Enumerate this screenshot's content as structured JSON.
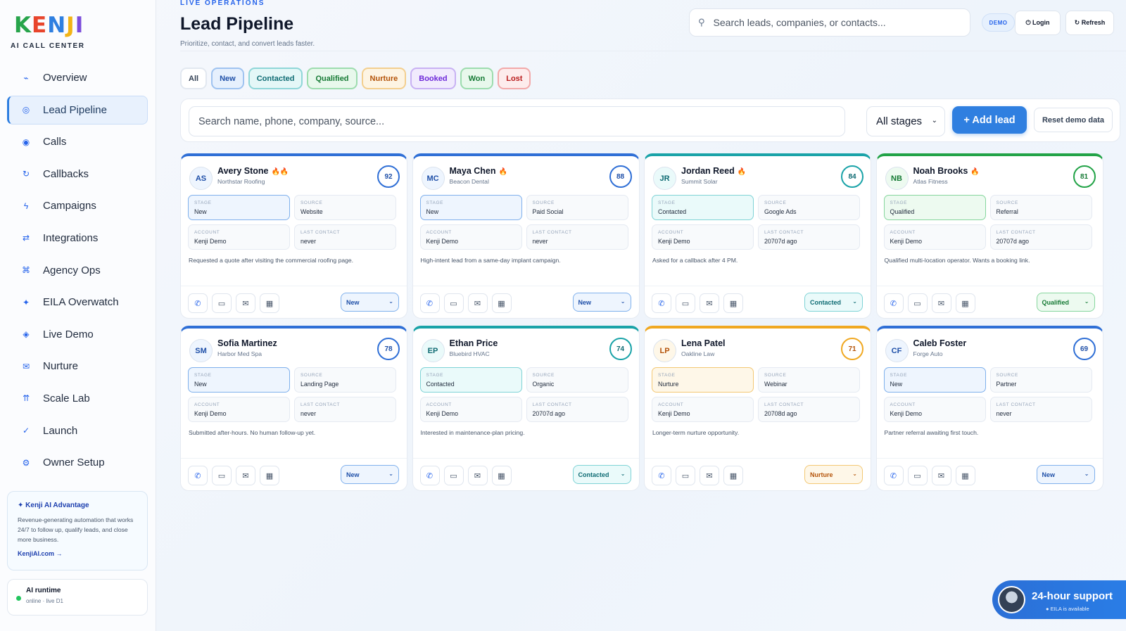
{
  "brand": {
    "logo_letters": [
      "K",
      "E",
      "N",
      "J",
      "I"
    ],
    "subtitle": "AI CALL CENTER"
  },
  "sidebar": {
    "items": [
      {
        "label": "Overview",
        "icon": "trend-icon",
        "glyph": "⌁"
      },
      {
        "label": "Lead Pipeline",
        "icon": "target-icon",
        "glyph": "◎",
        "active": true
      },
      {
        "label": "Calls",
        "icon": "record-icon",
        "glyph": "◉"
      },
      {
        "label": "Callbacks",
        "icon": "redo-icon",
        "glyph": "↻"
      },
      {
        "label": "Campaigns",
        "icon": "bolt-icon",
        "glyph": "ϟ"
      },
      {
        "label": "Integrations",
        "icon": "swap-icon",
        "glyph": "⇄"
      },
      {
        "label": "Agency Ops",
        "icon": "command-icon",
        "glyph": "⌘"
      },
      {
        "label": "EILA Overwatch",
        "icon": "sparkle-icon",
        "glyph": "✦"
      },
      {
        "label": "Live Demo",
        "icon": "diamond-icon",
        "glyph": "◈"
      },
      {
        "label": "Nurture",
        "icon": "mail-icon",
        "glyph": "✉"
      },
      {
        "label": "Scale Lab",
        "icon": "arrows-up-icon",
        "glyph": "⇈"
      },
      {
        "label": "Launch",
        "icon": "check-icon",
        "glyph": "✓"
      },
      {
        "label": "Owner Setup",
        "icon": "gear-icon",
        "glyph": "⚙"
      }
    ],
    "promo": {
      "title": "✦ Kenji AI Advantage",
      "text": "Revenue-generating automation that works 24/7 to follow up, qualify leads, and close more business.",
      "link": "KenjiAI.com →"
    },
    "runtime": {
      "title": "AI runtime",
      "status": "online · live D1"
    }
  },
  "header": {
    "eyebrow": "LIVE OPERATIONS",
    "title": "Lead Pipeline",
    "subtitle": "Prioritize, contact, and convert leads faster.",
    "search_placeholder": "Search leads, companies, or contacts...",
    "demo_badge": "DEMO",
    "login_label": "⏻ Login",
    "refresh_label": "↻ Refresh"
  },
  "filters": {
    "chips": [
      {
        "label": "All",
        "color": "#334155",
        "bg": "#ffffff",
        "border": "#e2e8f0"
      },
      {
        "label": "New",
        "color": "#1e4fa8",
        "bg": "#e6f0fd",
        "border": "#9fc3f0"
      },
      {
        "label": "Contacted",
        "color": "#0e6b73",
        "bg": "#e4f7f7",
        "border": "#8fd6d8"
      },
      {
        "label": "Qualified",
        "color": "#157a34",
        "bg": "#e8f8ec",
        "border": "#9ddcae"
      },
      {
        "label": "Nurture",
        "color": "#b45309",
        "bg": "#fdf4e3",
        "border": "#f3cf8f"
      },
      {
        "label": "Booked",
        "color": "#6d28d9",
        "bg": "#f1ebfd",
        "border": "#c8b1f3"
      },
      {
        "label": "Won",
        "color": "#157a34",
        "bg": "#e8f8ec",
        "border": "#9ddcae"
      },
      {
        "label": "Lost",
        "color": "#b91c1c",
        "bg": "#fdecec",
        "border": "#f2a9a9"
      }
    ]
  },
  "toolbar": {
    "search_placeholder": "Search name, phone, company, source...",
    "stage_select": "All stages",
    "add_lead": "+ Add lead",
    "reset": "Reset demo data"
  },
  "labels": {
    "stage": "STAGE",
    "source": "SOURCE",
    "account": "ACCOUNT",
    "last_contact": "LAST CONTACT"
  },
  "leads": [
    {
      "initials": "AS",
      "name": "Avery Stone",
      "flames": "🔥🔥",
      "company": "Northstar Roofing",
      "score": "92",
      "stage": "New",
      "source": "Website",
      "account": "Kenji Demo",
      "last_contact": "never",
      "note": "Requested a quote after visiting the commercial roofing page."
    },
    {
      "initials": "MC",
      "name": "Maya Chen",
      "flames": "🔥",
      "company": "Beacon Dental",
      "score": "88",
      "stage": "New",
      "source": "Paid Social",
      "account": "Kenji Demo",
      "last_contact": "never",
      "note": "High-intent lead from a same-day implant campaign."
    },
    {
      "initials": "JR",
      "name": "Jordan Reed",
      "flames": "🔥",
      "company": "Summit Solar",
      "score": "84",
      "stage": "Contacted",
      "source": "Google Ads",
      "account": "Kenji Demo",
      "last_contact": "20707d ago",
      "note": "Asked for a callback after 4 PM."
    },
    {
      "initials": "NB",
      "name": "Noah Brooks",
      "flames": "🔥",
      "company": "Atlas Fitness",
      "score": "81",
      "stage": "Qualified",
      "source": "Referral",
      "account": "Kenji Demo",
      "last_contact": "20707d ago",
      "note": "Qualified multi-location operator. Wants a booking link."
    },
    {
      "initials": "SM",
      "name": "Sofia Martinez",
      "flames": "",
      "company": "Harbor Med Spa",
      "score": "78",
      "stage": "New",
      "source": "Landing Page",
      "account": "Kenji Demo",
      "last_contact": "never",
      "note": "Submitted after-hours. No human follow-up yet."
    },
    {
      "initials": "EP",
      "name": "Ethan Price",
      "flames": "",
      "company": "Bluebird HVAC",
      "score": "74",
      "stage": "Contacted",
      "source": "Organic",
      "account": "Kenji Demo",
      "last_contact": "20707d ago",
      "note": "Interested in maintenance-plan pricing."
    },
    {
      "initials": "LP",
      "name": "Lena Patel",
      "flames": "",
      "company": "Oakline Law",
      "score": "71",
      "stage": "Nurture",
      "source": "Webinar",
      "account": "Kenji Demo",
      "last_contact": "20708d ago",
      "note": "Longer-term nurture opportunity."
    },
    {
      "initials": "CF",
      "name": "Caleb Foster",
      "flames": "",
      "company": "Forge Auto",
      "score": "69",
      "stage": "New",
      "source": "Partner",
      "account": "Kenji Demo",
      "last_contact": "never",
      "note": "Partner referral awaiting first touch."
    }
  ],
  "stage_colors": {
    "New": {
      "fg": "#1e4fa8",
      "bg": "#eef5fe",
      "border": "#7fb0ec",
      "top": "#2f6fd6"
    },
    "Contacted": {
      "fg": "#0e6b73",
      "bg": "#eafafa",
      "border": "#7fd3d6",
      "top": "#1aa3a8"
    },
    "Qualified": {
      "fg": "#157a34",
      "bg": "#edfaf0",
      "border": "#86d69d",
      "top": "#22a347"
    },
    "Nurture": {
      "fg": "#b45309",
      "bg": "#fef7e8",
      "border": "#f3c874",
      "top": "#f0a821"
    }
  },
  "support": {
    "title": "24-hour support",
    "sub": "● EILA is available"
  }
}
